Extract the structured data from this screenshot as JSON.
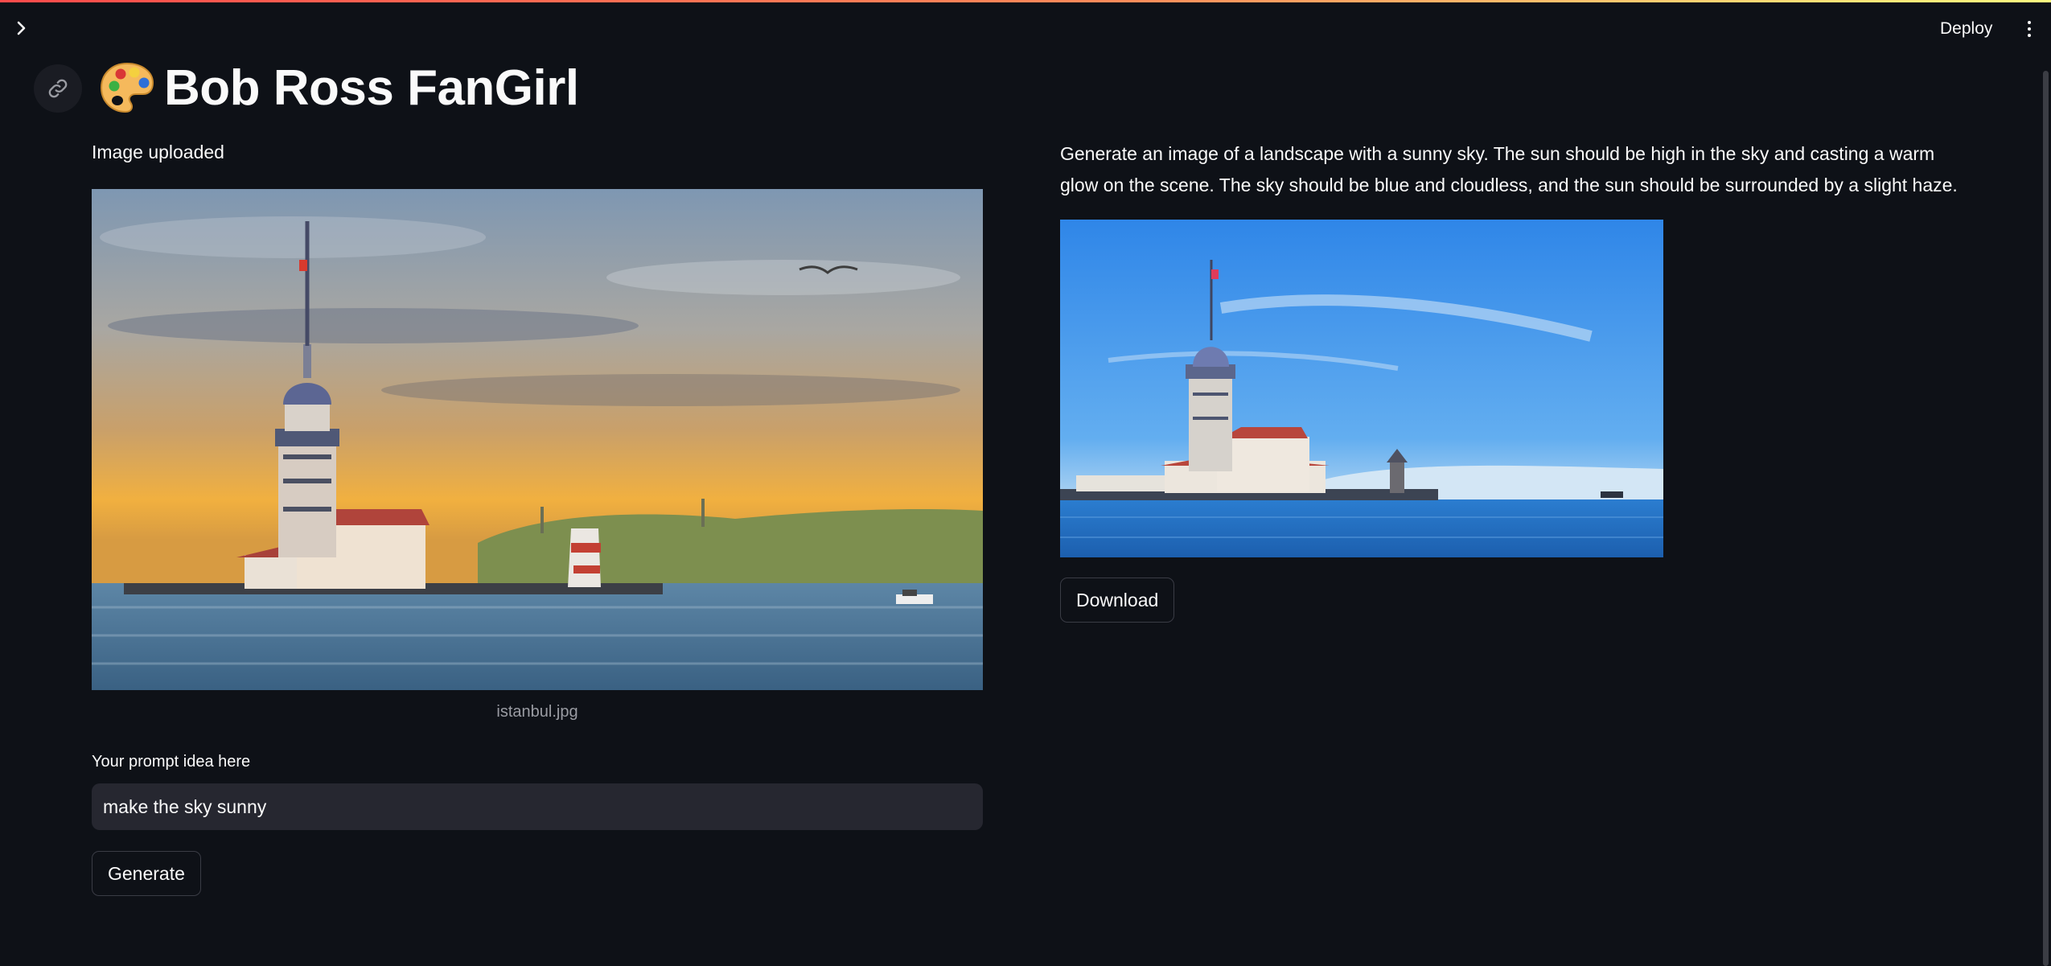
{
  "header": {
    "deploy_label": "Deploy",
    "icons": {
      "sidebar_toggle": "chevron-right-icon",
      "menu": "kebab-menu-icon"
    }
  },
  "page": {
    "title_emoji": "🎨",
    "title": "Bob Ross FanGirl",
    "anchor_icon": "link-icon"
  },
  "left": {
    "upload_status": "Image uploaded",
    "image_caption": "istanbul.jpg",
    "prompt_label": "Your prompt idea here",
    "prompt_value": "make the sky sunny",
    "generate_label": "Generate"
  },
  "right": {
    "generated_prompt": "Generate an image of a landscape with a sunny sky. The sun should be high in the sky and casting a warm glow on the scene. The sky should be blue and cloudless, and the sun should be surrounded by a slight haze.",
    "download_label": "Download"
  },
  "colors": {
    "background": "#0e1117",
    "input_background": "#262730",
    "accent_gradient": [
      "#ff4b4b",
      "#fffd80"
    ]
  }
}
